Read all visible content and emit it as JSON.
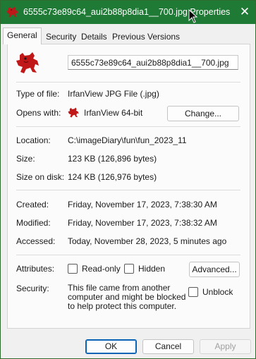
{
  "window": {
    "title": "6555c73e89c64_aui2b88p8dia1__700.jpg Properties",
    "close_glyph": "✕",
    "accent_color": "#1f7a35",
    "app_icon": "irfanview-red-cat-icon"
  },
  "tabs": [
    {
      "label": "General"
    },
    {
      "label": "Security"
    },
    {
      "label": "Details"
    },
    {
      "label": "Previous Versions"
    }
  ],
  "general": {
    "file_name": "6555c73e89c64_aui2b88p8dia1__700.jpg",
    "type_label": "Type of file:",
    "type_value": "IrfanView JPG File (.jpg)",
    "opens_label": "Opens with:",
    "opens_value": "IrfanView 64-bit",
    "change_button": "Change...",
    "location_label": "Location:",
    "location_value": "C:\\imageDiary\\fun\\fun_2023_11",
    "size_label": "Size:",
    "size_value": "123 KB (126,896 bytes)",
    "size_on_disk_label": "Size on disk:",
    "size_on_disk_value": "124 KB (126,976 bytes)",
    "created_label": "Created:",
    "created_value": "Friday, November 17, 2023, 7:38:30 AM",
    "modified_label": "Modified:",
    "modified_value": "Friday, November 17, 2023, 7:38:32 AM",
    "accessed_label": "Accessed:",
    "accessed_value": "Today, November 28, 2023, 5 minutes ago",
    "attributes_label": "Attributes:",
    "readonly_label": "Read-only",
    "hidden_label": "Hidden",
    "advanced_button": "Advanced...",
    "security_label": "Security:",
    "security_text": "This file came from another computer and might be blocked to help protect this computer.",
    "unblock_label": "Unblock"
  },
  "footer": {
    "ok": "OK",
    "cancel": "Cancel",
    "apply": "Apply"
  }
}
